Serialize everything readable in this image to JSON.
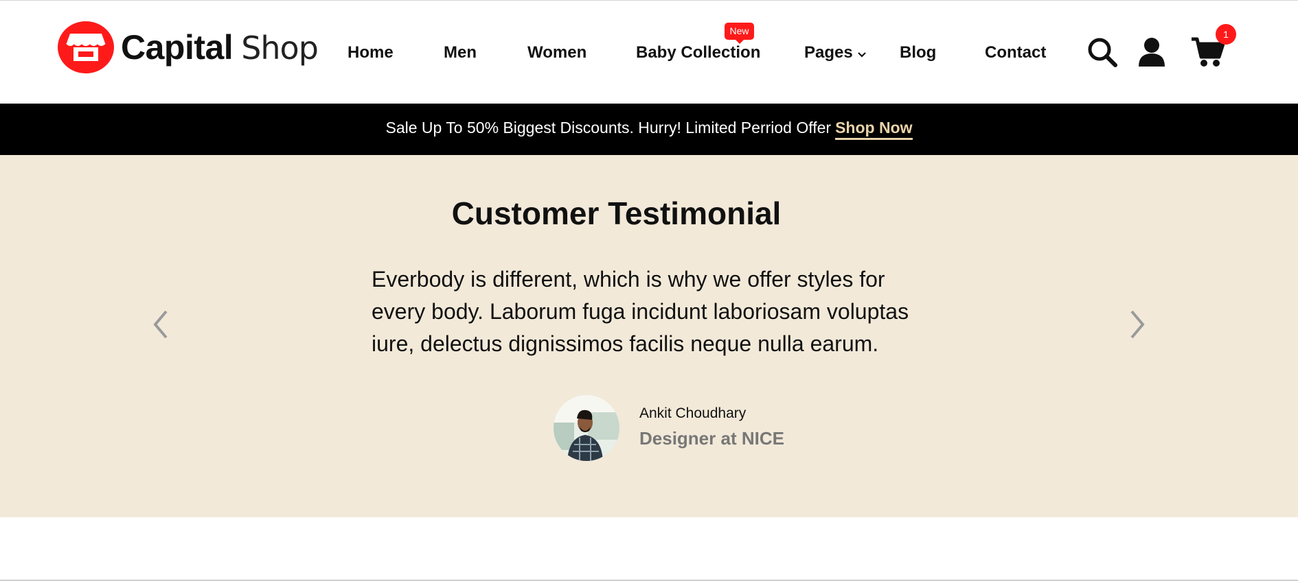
{
  "header": {
    "brand_bold": "Capital",
    "brand_light": "Shop",
    "nav": [
      {
        "label": "Home"
      },
      {
        "label": "Men"
      },
      {
        "label": "Women"
      },
      {
        "label": "Baby Collection",
        "badge": "New"
      },
      {
        "label": "Pages",
        "has_dropdown": true
      },
      {
        "label": "Blog"
      },
      {
        "label": "Contact"
      }
    ],
    "icons": [
      "search-icon",
      "user-icon",
      "cart-icon"
    ],
    "cart_count": "1"
  },
  "promo": {
    "text": "Sale Up To 50% Biggest Discounts. Hurry! Limited Perriod Offer",
    "link_label": "Shop Now"
  },
  "testimonial": {
    "title": "Customer Testimonial",
    "quote": "Everbody is different, which is why we offer styles for every body. Laborum fuga incidunt laboriosam voluptas iure, delectus dignissimos facilis neque nulla earum.",
    "author_name": "Ankit Choudhary",
    "author_role": "Designer at NICE"
  },
  "colors": {
    "brand_red": "#ff1a1a",
    "promo_bg": "#000000",
    "promo_link": "#e9d3a9",
    "testimonial_bg": "#f2e9d9",
    "arrow_gray": "#9a9a9a",
    "muted_text": "#777777"
  }
}
